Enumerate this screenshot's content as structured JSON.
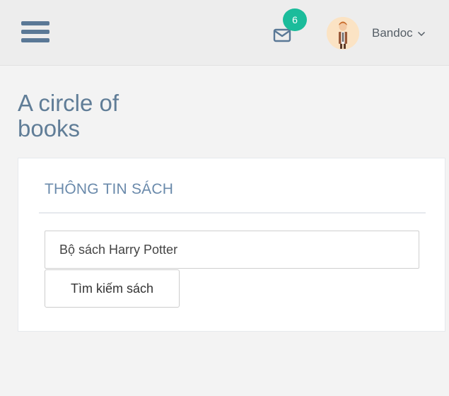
{
  "topbar": {
    "menu_icon": "hamburger-menu-icon",
    "mail_icon": "envelope-icon",
    "notification_count": "6",
    "avatar_icon": "user-avatar-icon",
    "username": "Bandoc",
    "dropdown_icon": "chevron-down-icon"
  },
  "app": {
    "title": "A circle of books"
  },
  "panel": {
    "heading": "THÔNG TIN SÁCH",
    "book_input_value": "Bộ sách Harry Potter",
    "search_button_label": "Tìm kiếm sách"
  },
  "colors": {
    "topbar_bg": "#ededed",
    "page_bg": "#f3f3f3",
    "icon_blue": "#5a7896",
    "title_blue": "#607d97",
    "heading_blue": "#6a8aab",
    "badge_green": "#1bbc9b"
  }
}
